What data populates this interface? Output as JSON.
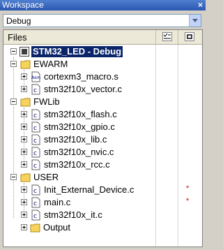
{
  "window": {
    "title": "Workspace",
    "close_label": "×"
  },
  "configuration": {
    "selected": "Debug"
  },
  "header": {
    "files": "Files"
  },
  "tree": {
    "project": "STM32_LED - Debug",
    "ewarm": "EWARM",
    "ewarm_items": [
      "cortexm3_macro.s",
      "stm32f10x_vector.c"
    ],
    "fwlib": "FWLib",
    "fwlib_items": [
      "stm32f10x_flash.c",
      "stm32f10x_gpio.c",
      "stm32f10x_lib.c",
      "stm32f10x_nvic.c",
      "stm32f10x_rcc.c"
    ],
    "user": "USER",
    "user_items": [
      "Init_External_Device.c",
      "main.c",
      "stm32f10x_it.c"
    ],
    "output": "Output"
  },
  "marks": {
    "check": "✔",
    "star": "*"
  },
  "icons": {
    "asm_badge": "Asm"
  }
}
